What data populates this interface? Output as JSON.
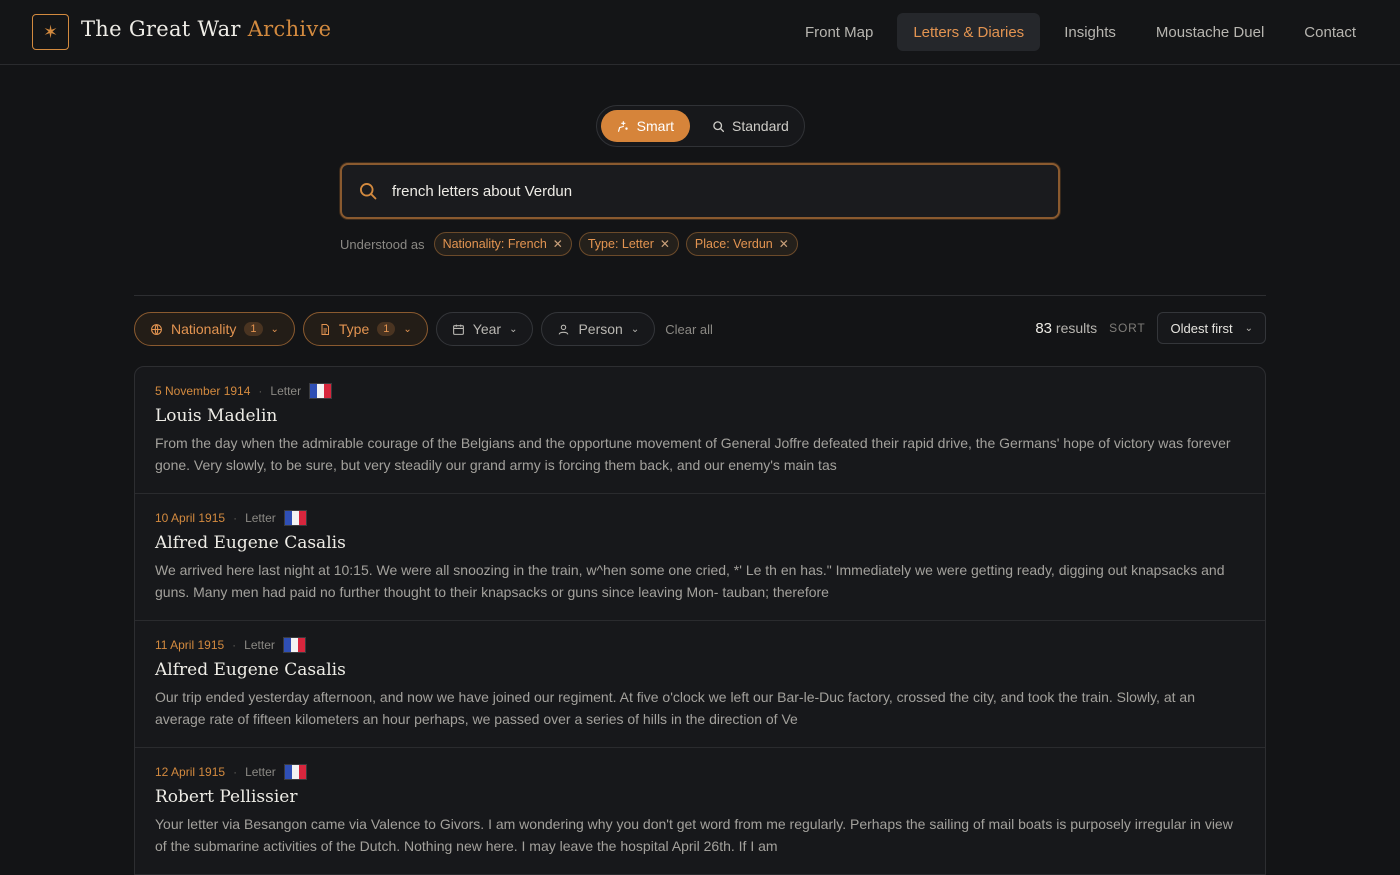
{
  "header": {
    "brand_main": "The Great War",
    "brand_accent": "Archive",
    "logo_glyph": "✶",
    "nav": [
      {
        "label": "Front Map",
        "active": false
      },
      {
        "label": "Letters & Diaries",
        "active": true
      },
      {
        "label": "Insights",
        "active": false
      },
      {
        "label": "Moustache Duel",
        "active": false
      },
      {
        "label": "Contact",
        "active": false
      }
    ]
  },
  "search": {
    "modes": {
      "smart": "Smart",
      "standard": "Standard"
    },
    "active_mode": "smart",
    "query": "french letters about Verdun"
  },
  "understood": {
    "label": "Understood as",
    "chips": [
      "Nationality: French",
      "Type: Letter",
      "Place: Verdun"
    ]
  },
  "filters": {
    "nationality": {
      "label": "Nationality",
      "count": "1"
    },
    "type": {
      "label": "Type",
      "count": "1"
    },
    "year": {
      "label": "Year"
    },
    "person": {
      "label": "Person"
    },
    "clear_all": "Clear all"
  },
  "results_meta": {
    "count": "83",
    "count_suffix": "results",
    "sort_label": "SORT",
    "sort_value": "Oldest first"
  },
  "colors": {
    "accent": "#d38a3f",
    "flag_blue": "#2f4fb5",
    "flag_white": "#f3f3f3",
    "flag_red": "#d7263d"
  },
  "results": [
    {
      "date": "5 November 1914",
      "type": "Letter",
      "name": "Louis Madelin",
      "excerpt": "From the day when the admirable courage of the Belgians and the opportune movement of General Joffre defeated their rapid drive, the Germans' hope of victory was forever gone. Very slowly, to be sure, but very steadily our grand army is forcing them back, and our enemy's main tas"
    },
    {
      "date": "10 April 1915",
      "type": "Letter",
      "name": "Alfred Eugene Casalis",
      "excerpt": "We arrived here last night at 10:15. We were all snoozing in the train, w^hen some one cried, *' Le th en has.\" Immediately we were getting ready, digging out knapsacks and guns. Many men had paid no further thought to their knapsacks or guns since leaving Mon- tauban; therefore"
    },
    {
      "date": "11 April 1915",
      "type": "Letter",
      "name": "Alfred Eugene Casalis",
      "excerpt": "Our trip ended yesterday afternoon, and now we have joined our regiment. At five o'clock we left our Bar-le-Duc factory, crossed the city, and took the train. Slowly, at an average rate of fifteen kilometers an hour perhaps, we passed over a series of hills in the direction of Ve"
    },
    {
      "date": "12 April 1915",
      "type": "Letter",
      "name": "Robert Pellissier",
      "excerpt": "Your letter via Besangon came via Valence to Givors. I am wondering why you don't get word from me regularly. Perhaps the sailing of mail boats is purposely irregular in view of the submarine activities of the Dutch. Nothing new here. I may leave the hospital April 26th. If I am"
    }
  ]
}
